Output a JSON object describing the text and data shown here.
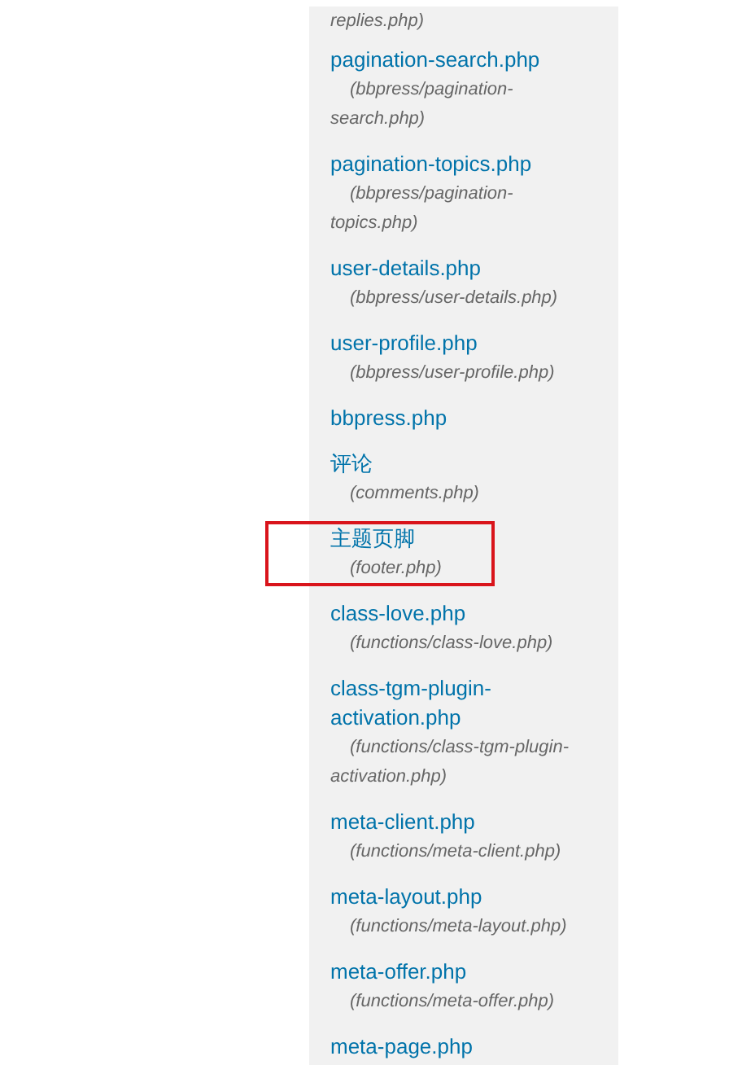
{
  "top_fragment": "replies.php)",
  "files": [
    {
      "name": "pagination-search.php",
      "path": "(bbpress/pagination-search.php)",
      "highlighted": false
    },
    {
      "name": "pagination-topics.php",
      "path": "(bbpress/pagination-topics.php)",
      "highlighted": false
    },
    {
      "name": "user-details.php",
      "path": "(bbpress/user-details.php)",
      "highlighted": false
    },
    {
      "name": "user-profile.php",
      "path": "(bbpress/user-profile.php)",
      "highlighted": false
    },
    {
      "name": "bbpress.php",
      "highlighted": false
    },
    {
      "name": "评论",
      "path": "(comments.php)",
      "highlighted": false
    },
    {
      "name": "主题页脚",
      "path": "(footer.php)",
      "highlighted": true
    },
    {
      "name": "class-love.php",
      "path": "(functions/class-love.php)",
      "highlighted": false
    },
    {
      "name": "class-tgm-plugin-activation.php",
      "path": "(functions/class-tgm-plugin-activation.php)",
      "highlighted": false
    },
    {
      "name": "meta-client.php",
      "path": "(functions/meta-client.php)",
      "highlighted": false
    },
    {
      "name": "meta-layout.php",
      "path": "(functions/meta-layout.php)",
      "highlighted": false
    },
    {
      "name": "meta-offer.php",
      "path": "(functions/meta-offer.php)",
      "highlighted": false
    },
    {
      "name": "meta-page.php",
      "highlighted": false
    }
  ]
}
